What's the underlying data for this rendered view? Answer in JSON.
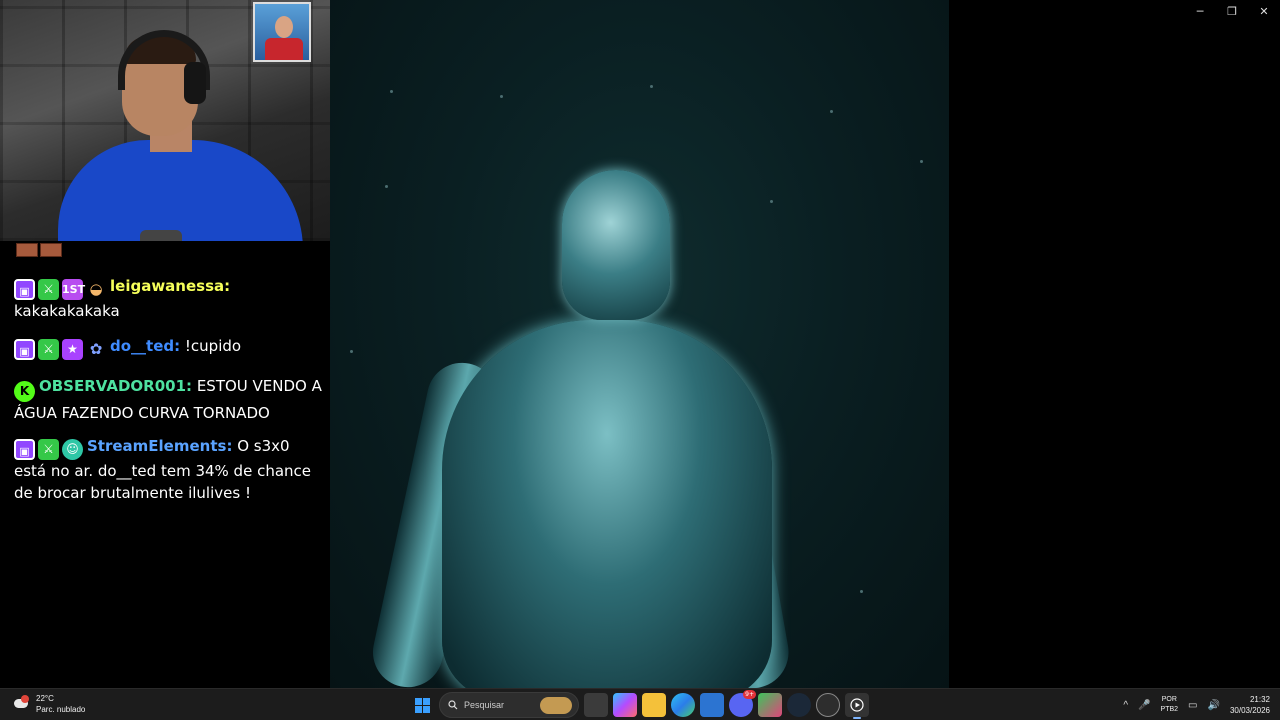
{
  "window_controls": {
    "minimize": "─",
    "restore": "❐",
    "close": "✕"
  },
  "chat": {
    "messages": [
      {
        "badges": [
          "twitch-badge",
          "sword-badge",
          "first-badge",
          "emote-badge"
        ],
        "user": "leigawanessa:",
        "text": "kakakakakaka",
        "user_color": "#f6ff5a"
      },
      {
        "badges": [
          "twitch-badge",
          "sword-badge",
          "star-badge",
          "ghost-badge"
        ],
        "user": "do__ted:",
        "text": "!cupido",
        "user_color": "#3f8cff"
      },
      {
        "badges": [
          "kick-badge"
        ],
        "user": "OBSERVADOR001:",
        "text": "ESTOU VENDO A ÁGUA FAZENDO CURVA TORNADO",
        "user_color": "#4ee2a0"
      },
      {
        "badges": [
          "twitch-badge",
          "sword-badge",
          "bot-badge"
        ],
        "user": "StreamElements:",
        "text": "O s3x0 está no ar. do__ted tem 34% de chance de brocar brutalmente ilulives !",
        "user_color": "#5aa3ff"
      }
    ],
    "badge_glyphs": {
      "twitch": "▣",
      "sword": "⚔",
      "first": "1ST",
      "star": "★",
      "bot": "☺",
      "kick": "K",
      "emote": "◒",
      "ghost": "✿"
    }
  },
  "taskbar": {
    "weather": {
      "temp": "22°C",
      "condition": "Parc. nublado"
    },
    "search_placeholder": "Pesquisar",
    "tray": {
      "lang_line1": "POR",
      "lang_line2": "PTB2",
      "time": "21:32",
      "date": "30/03/2026",
      "chevron": "^",
      "mic": "🎤",
      "network": "▭",
      "volume": "🔊"
    },
    "app_badge": "9+"
  }
}
